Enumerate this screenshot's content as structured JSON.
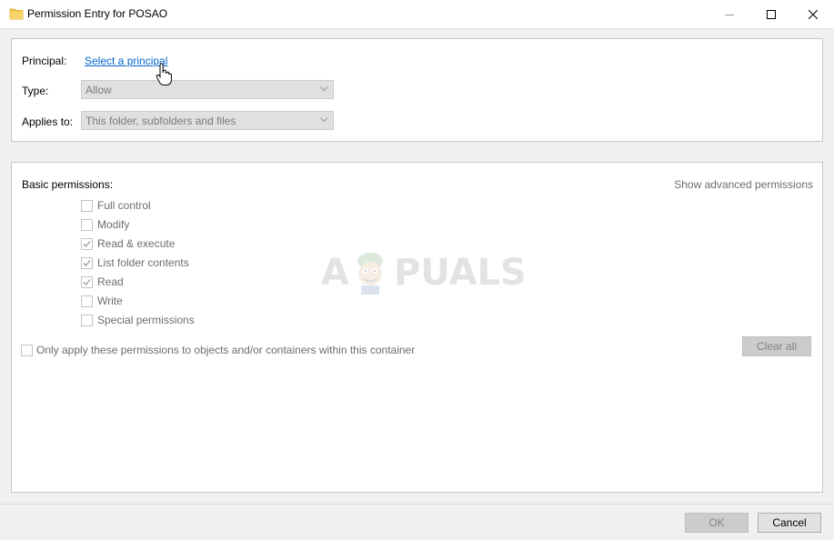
{
  "window": {
    "title": "Permission Entry for POSAO",
    "icon": "folder-icon"
  },
  "colors": {
    "link": "#0066cc",
    "disabled_text": "#6d6d6d",
    "folder_yellow": "#f4c542"
  },
  "principal": {
    "label": "Principal:",
    "link": "Select a principal"
  },
  "type": {
    "label": "Type:",
    "value": "Allow"
  },
  "applies_to": {
    "label": "Applies to:",
    "value": "This folder, subfolders and files"
  },
  "basic_permissions": {
    "label": "Basic permissions:",
    "advanced_link": "Show advanced permissions",
    "items": [
      {
        "label": "Full control",
        "checked": false
      },
      {
        "label": "Modify",
        "checked": false
      },
      {
        "label": "Read & execute",
        "checked": true
      },
      {
        "label": "List folder contents",
        "checked": true
      },
      {
        "label": "Read",
        "checked": true
      },
      {
        "label": "Write",
        "checked": false
      },
      {
        "label": "Special permissions",
        "checked": false
      }
    ]
  },
  "only_apply": {
    "label": "Only apply these permissions to objects and/or containers within this container",
    "checked": false
  },
  "buttons": {
    "clear_all": "Clear all",
    "ok": "OK",
    "cancel": "Cancel"
  },
  "watermark": {
    "text_left": "A",
    "text_right": "PUALS"
  }
}
